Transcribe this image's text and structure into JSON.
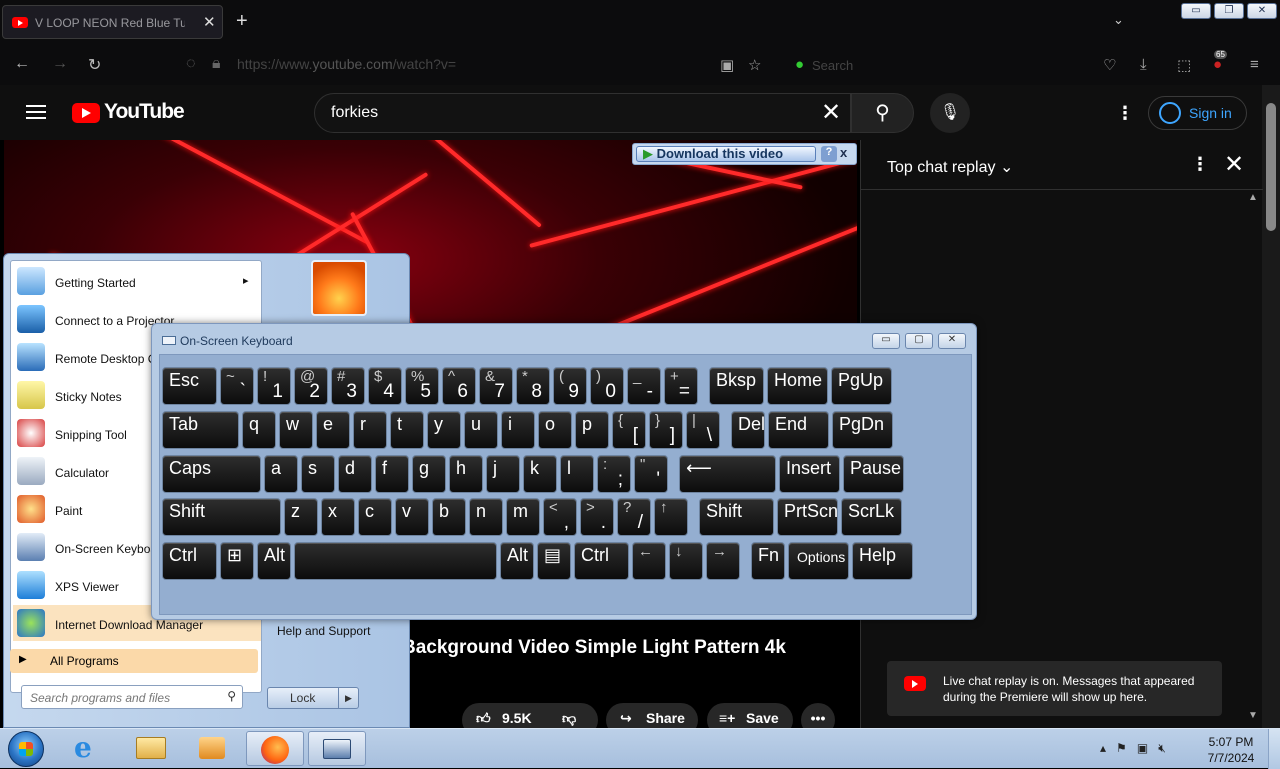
{
  "browser": {
    "tab_title": "V LOOP NEON Red Blue Turn",
    "new_tab": "+",
    "url_prefix": "https://www.",
    "url_domain": "youtube.com",
    "url_path": "/watch?v=",
    "search_placeholder": "Search",
    "badge_count": "65"
  },
  "youtube": {
    "logo_text": "YouTube",
    "search_query": "forkies",
    "sign_in": "Sign in",
    "video_title": "Background Video Simple Light Pattern 4k",
    "likes": "9.5K",
    "share": "Share",
    "save": "Save"
  },
  "download_bar": {
    "label": "Download this video",
    "help": "?",
    "close": "x"
  },
  "chat": {
    "title": "Top chat replay",
    "notice": "Live chat replay is on. Messages that appeared during the Premiere will show up here."
  },
  "start_menu": {
    "items": [
      {
        "label": "Getting Started",
        "arrow": "▸"
      },
      {
        "label": "Connect to a Projector"
      },
      {
        "label": "Remote Desktop Connection"
      },
      {
        "label": "Sticky Notes"
      },
      {
        "label": "Snipping Tool"
      },
      {
        "label": "Calculator"
      },
      {
        "label": "Paint"
      },
      {
        "label": "On-Screen Keyboard"
      },
      {
        "label": "XPS Viewer"
      },
      {
        "label": "Internet Download Manager"
      }
    ],
    "all_programs": "All Programs",
    "search_placeholder": "Search programs and files",
    "help_support": "Help and Support",
    "lock": "Lock"
  },
  "osk": {
    "title": "On-Screen Keyboard",
    "rows": [
      [
        {
          "m": "Esc",
          "w": 58
        },
        {
          "sh": "~",
          "lo": "`",
          "w": 37
        },
        {
          "sh": "!",
          "lo": "1",
          "w": 37
        },
        {
          "sh": "@",
          "lo": "2",
          "w": 37
        },
        {
          "sh": "#",
          "lo": "3",
          "w": 37
        },
        {
          "sh": "$",
          "lo": "4",
          "w": 37
        },
        {
          "sh": "%",
          "lo": "5",
          "w": 37
        },
        {
          "sh": "^",
          "lo": "6",
          "w": 37
        },
        {
          "sh": "&",
          "lo": "7",
          "w": 37
        },
        {
          "sh": "*",
          "lo": "8",
          "w": 37
        },
        {
          "sh": "(",
          "lo": "9",
          "w": 37
        },
        {
          "sh": ")",
          "lo": "0",
          "w": 37
        },
        {
          "sh": "_",
          "lo": "-",
          "w": 37
        },
        {
          "sh": "+",
          "lo": "=",
          "w": 37
        },
        {
          "m": "Bksp",
          "w": 58,
          "gap": 8
        },
        {
          "m": "Home",
          "w": 64
        },
        {
          "m": "PgUp",
          "w": 64
        }
      ],
      [
        {
          "m": "Tab",
          "w": 80
        },
        {
          "m": "q",
          "w": 37
        },
        {
          "m": "w",
          "w": 37
        },
        {
          "m": "e",
          "w": 37
        },
        {
          "m": "r",
          "w": 37
        },
        {
          "m": "t",
          "w": 37
        },
        {
          "m": "y",
          "w": 37
        },
        {
          "m": "u",
          "w": 37
        },
        {
          "m": "i",
          "w": 37
        },
        {
          "m": "o",
          "w": 37
        },
        {
          "m": "p",
          "w": 37
        },
        {
          "sh": "{",
          "lo": "[",
          "w": 37
        },
        {
          "sh": "}",
          "lo": "]",
          "w": 37
        },
        {
          "sh": "|",
          "lo": "\\",
          "w": 37
        },
        {
          "m": "Del",
          "w": 37,
          "gap": 8
        },
        {
          "m": "End",
          "w": 64
        },
        {
          "m": "PgDn",
          "w": 64
        }
      ],
      [
        {
          "m": "Caps",
          "w": 102
        },
        {
          "m": "a",
          "w": 37
        },
        {
          "m": "s",
          "w": 37
        },
        {
          "m": "d",
          "w": 37
        },
        {
          "m": "f",
          "w": 37
        },
        {
          "m": "g",
          "w": 37
        },
        {
          "m": "h",
          "w": 37
        },
        {
          "m": "j",
          "w": 37
        },
        {
          "m": "k",
          "w": 37
        },
        {
          "m": "l",
          "w": 37
        },
        {
          "sh": ":",
          "lo": ";",
          "w": 37
        },
        {
          "sh": "\"",
          "lo": "'",
          "w": 37
        },
        {
          "m": "⟵",
          "w": 100,
          "gap": 8
        },
        {
          "m": "Insert",
          "w": 64
        },
        {
          "m": "Pause",
          "w": 64
        }
      ],
      [
        {
          "m": "Shift",
          "w": 122
        },
        {
          "m": "z",
          "w": 37
        },
        {
          "m": "x",
          "w": 37
        },
        {
          "m": "c",
          "w": 37
        },
        {
          "m": "v",
          "w": 37
        },
        {
          "m": "b",
          "w": 37
        },
        {
          "m": "n",
          "w": 37
        },
        {
          "m": "m",
          "w": 37
        },
        {
          "sh": "<",
          "lo": ",",
          "w": 37
        },
        {
          "sh": ">",
          "lo": ".",
          "w": 37
        },
        {
          "sh": "?",
          "lo": "/",
          "w": 37
        },
        {
          "sh": "↑",
          "lo": "",
          "w": 37
        },
        {
          "m": "Shift",
          "w": 78,
          "gap": 8
        },
        {
          "m": "PrtScn",
          "w": 64
        },
        {
          "m": "ScrLk",
          "w": 64
        }
      ],
      [
        {
          "m": "Ctrl",
          "w": 58
        },
        {
          "m": "⊞",
          "w": 37
        },
        {
          "m": "Alt",
          "w": 37
        },
        {
          "m": "",
          "w": 206
        },
        {
          "m": "Alt",
          "w": 37
        },
        {
          "m": "▤",
          "w": 37
        },
        {
          "m": "Ctrl",
          "w": 58
        },
        {
          "sh": "←",
          "lo": "",
          "w": 37
        },
        {
          "sh": "↓",
          "lo": "",
          "w": 37
        },
        {
          "sh": "→",
          "lo": "",
          "w": 37
        },
        {
          "m": "Fn",
          "w": 37,
          "gap": 8
        },
        {
          "m": "Options",
          "w": 64,
          "small": true
        },
        {
          "m": "Help",
          "w": 64
        }
      ]
    ]
  },
  "taskbar": {
    "time": "5:07 PM",
    "date": "7/7/2024"
  }
}
